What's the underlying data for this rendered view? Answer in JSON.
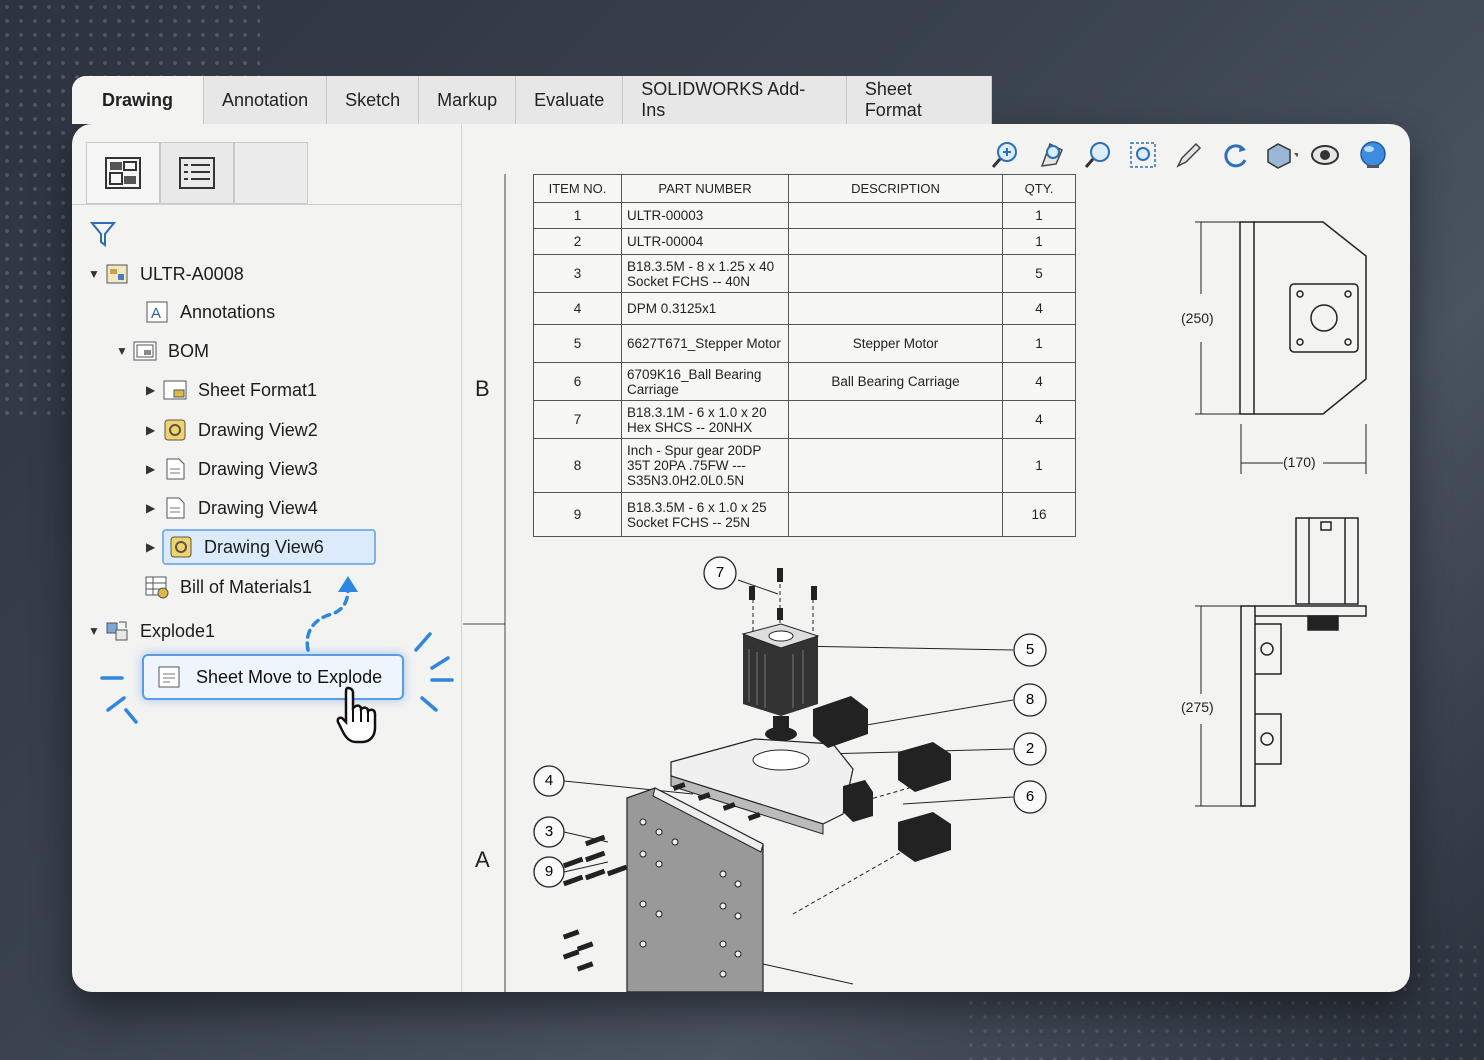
{
  "tabs": [
    "Drawing",
    "Annotation",
    "Sketch",
    "Markup",
    "Evaluate",
    "SOLIDWORKS Add-Ins",
    "Sheet Format"
  ],
  "tree": {
    "root": "ULTR-A0008",
    "annotations": "Annotations",
    "bom": "BOM",
    "children": [
      "Sheet Format1",
      "Drawing View2",
      "Drawing View3",
      "Drawing View4",
      "Drawing View6"
    ],
    "bill": "Bill of Materials1",
    "explode": "Explode1",
    "action": "Sheet Move to Explode"
  },
  "zones": {
    "top": "B",
    "bottom": "A"
  },
  "bom_table": {
    "headers": [
      "ITEM NO.",
      "PART NUMBER",
      "DESCRIPTION",
      "QTY."
    ],
    "rows": [
      {
        "item": "1",
        "part": "ULTR-00003",
        "desc": "",
        "qty": "1"
      },
      {
        "item": "2",
        "part": "ULTR-00004",
        "desc": "",
        "qty": "1"
      },
      {
        "item": "3",
        "part": "B18.3.5M - 8 x 1.25 x 40 Socket FCHS -- 40N",
        "desc": "",
        "qty": "5"
      },
      {
        "item": "4",
        "part": "DPM 0.3125x1",
        "desc": "",
        "qty": "4"
      },
      {
        "item": "5",
        "part": "6627T671_Stepper Motor",
        "desc": "Stepper Motor",
        "qty": "1"
      },
      {
        "item": "6",
        "part": "6709K16_Ball Bearing Carriage",
        "desc": "Ball Bearing Carriage",
        "qty": "4"
      },
      {
        "item": "7",
        "part": "B18.3.1M - 6 x 1.0 x 20 Hex SHCS -- 20NHX",
        "desc": "",
        "qty": "4"
      },
      {
        "item": "8",
        "part": "Inch - Spur gear 20DP 35T 20PA .75FW --- S35N3.0H2.0L0.5N",
        "desc": "",
        "qty": "1"
      },
      {
        "item": "9",
        "part": "B18.3.5M - 6 x 1.0 x 25 Socket FCHS -- 25N",
        "desc": "",
        "qty": "16"
      }
    ]
  },
  "dimensions": {
    "d250": "(250)",
    "d170": "(170)",
    "d275": "(275)"
  },
  "balloons": [
    "7",
    "5",
    "8",
    "2",
    "6",
    "4",
    "3",
    "9"
  ]
}
